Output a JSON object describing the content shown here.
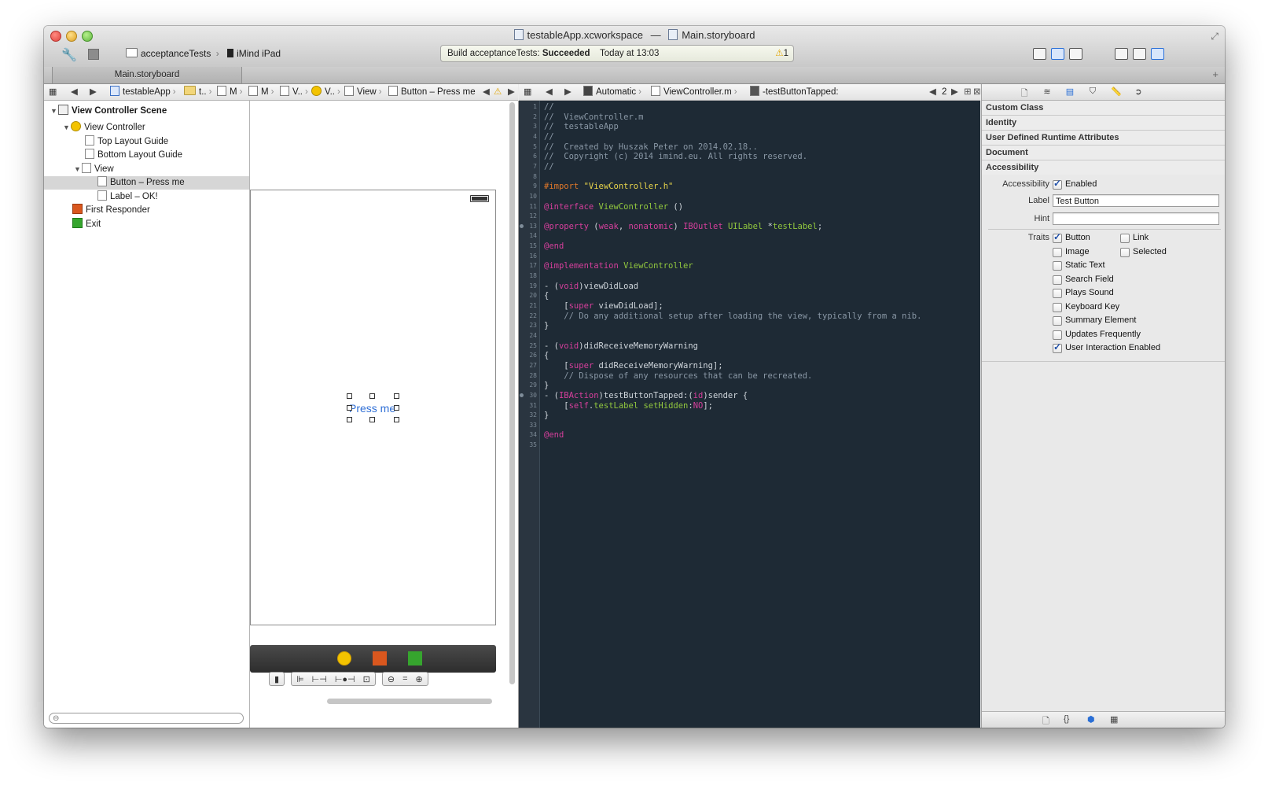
{
  "window": {
    "workspace": "testableApp.xcworkspace",
    "separator": "—",
    "document": "Main.storyboard"
  },
  "toolbar": {
    "scheme": "acceptanceTests",
    "destination": "iMind iPad",
    "activity_status_prefix": "Build acceptanceTests: ",
    "activity_status_result": "Succeeded",
    "activity_time": "Today at 13:03",
    "warning_count": "1"
  },
  "tabs": [
    {
      "label": "Main.storyboard"
    }
  ],
  "jumpbar_left": {
    "items": [
      "testableApp",
      "t..",
      "M",
      "M",
      "V..",
      "V..",
      "View",
      "Button – Press me"
    ]
  },
  "jumpbar_right": {
    "mode": "Automatic",
    "file": "ViewController.m",
    "method": "-testButtonTapped:",
    "counter": "2"
  },
  "outline": {
    "rows": [
      {
        "label": "View Controller Scene"
      },
      {
        "label": "View Controller"
      },
      {
        "label": "Top Layout Guide"
      },
      {
        "label": "Bottom Layout Guide"
      },
      {
        "label": "View"
      },
      {
        "label": "Button – Press me"
      },
      {
        "label": "Label – OK!"
      },
      {
        "label": "First Responder"
      },
      {
        "label": "Exit"
      }
    ]
  },
  "canvas": {
    "button_title": "Press me"
  },
  "code": {
    "lines": [
      "//",
      "//  ViewController.m",
      "//  testableApp",
      "//",
      "//  Created by Huszak Peter on 2014.02.18..",
      "//  Copyright (c) 2014 imind.eu. All rights reserved.",
      "//",
      "",
      "#import \"ViewController.h\"",
      "",
      "@interface ViewController ()",
      "",
      "@property (weak, nonatomic) IBOutlet UILabel *testLabel;",
      "",
      "@end",
      "",
      "@implementation ViewController",
      "",
      "- (void)viewDidLoad",
      "{",
      "    [super viewDidLoad];",
      "    // Do any additional setup after loading the view, typically from a nib.",
      "}",
      "",
      "- (void)didReceiveMemoryWarning",
      "{",
      "    [super didReceiveMemoryWarning];",
      "    // Dispose of any resources that can be recreated.",
      "}",
      "- (IBAction)testButtonTapped:(id)sender {",
      "    [self.testLabel setHidden:NO];",
      "}",
      "",
      "@end",
      ""
    ]
  },
  "inspector": {
    "sections": {
      "custom_class": "Custom Class",
      "identity": "Identity",
      "user_defined": "User Defined Runtime Attributes",
      "document": "Document",
      "accessibility": "Accessibility"
    },
    "accessibility_label": "Accessibility",
    "enabled_label": "Enabled",
    "label_label": "Label",
    "label_value": "Test Button",
    "hint_label": "Hint",
    "hint_value": "",
    "traits_label": "Traits",
    "traits": [
      {
        "label": "Button",
        "checked": true
      },
      {
        "label": "Link",
        "checked": false
      },
      {
        "label": "Image",
        "checked": false
      },
      {
        "label": "Selected",
        "checked": false
      },
      {
        "label": "Static Text",
        "checked": false
      },
      {
        "label": "Search Field",
        "checked": false
      },
      {
        "label": "Plays Sound",
        "checked": false
      },
      {
        "label": "Keyboard Key",
        "checked": false
      },
      {
        "label": "Summary Element",
        "checked": false
      },
      {
        "label": "Updates Frequently",
        "checked": false
      },
      {
        "label": "User Interaction Enabled",
        "checked": true
      }
    ]
  }
}
